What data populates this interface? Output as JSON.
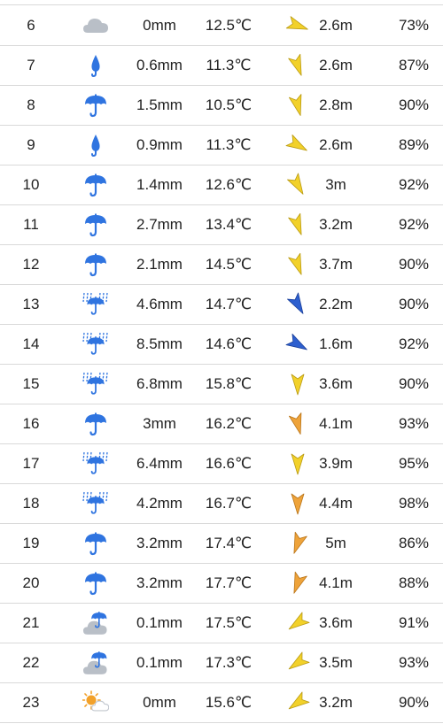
{
  "colors": {
    "divider": "#d9d9d9",
    "rain": "#2f74e0",
    "cloud": "#b9bfc7",
    "sun": "#f2a12a",
    "wind_yellow": "#f2d12a",
    "wind_orange": "#eea33a",
    "wind_blue": "#2d5fcf"
  },
  "rows": [
    {
      "hour": "6",
      "icon": "cloud-icon",
      "precip": "0mm",
      "temp": "12.5℃",
      "wind_dir": 110,
      "wind_color": "yellow",
      "wind": "2.6m",
      "humidity": "73%"
    },
    {
      "hour": "7",
      "icon": "raindrop-icon",
      "precip": "0.6mm",
      "temp": "11.3℃",
      "wind_dir": 160,
      "wind_color": "yellow",
      "wind": "2.6m",
      "humidity": "87%"
    },
    {
      "hour": "8",
      "icon": "umbrella-icon",
      "precip": "1.5mm",
      "temp": "10.5℃",
      "wind_dir": 165,
      "wind_color": "yellow",
      "wind": "2.8m",
      "humidity": "90%"
    },
    {
      "hour": "9",
      "icon": "raindrop-icon",
      "precip": "0.9mm",
      "temp": "11.3℃",
      "wind_dir": 120,
      "wind_color": "yellow",
      "wind": "2.6m",
      "humidity": "89%"
    },
    {
      "hour": "10",
      "icon": "umbrella-icon",
      "precip": "1.4mm",
      "temp": "12.6℃",
      "wind_dir": 150,
      "wind_color": "yellow",
      "wind": "3m",
      "humidity": "92%"
    },
    {
      "hour": "11",
      "icon": "umbrella-icon",
      "precip": "2.7mm",
      "temp": "13.4℃",
      "wind_dir": 160,
      "wind_color": "yellow",
      "wind": "3.2m",
      "humidity": "92%"
    },
    {
      "hour": "12",
      "icon": "umbrella-icon",
      "precip": "2.1mm",
      "temp": "14.5℃",
      "wind_dir": 160,
      "wind_color": "yellow",
      "wind": "3.7m",
      "humidity": "90%"
    },
    {
      "hour": "13",
      "icon": "umbrella-rain-icon",
      "precip": "4.6mm",
      "temp": "14.7℃",
      "wind_dir": 150,
      "wind_color": "blue",
      "wind": "2.2m",
      "humidity": "90%"
    },
    {
      "hour": "14",
      "icon": "umbrella-rain-icon",
      "precip": "8.5mm",
      "temp": "14.6℃",
      "wind_dir": 120,
      "wind_color": "blue",
      "wind": "1.6m",
      "humidity": "92%"
    },
    {
      "hour": "15",
      "icon": "umbrella-rain-icon",
      "precip": "6.8mm",
      "temp": "15.8℃",
      "wind_dir": 180,
      "wind_color": "yellow",
      "wind": "3.6m",
      "humidity": "90%"
    },
    {
      "hour": "16",
      "icon": "umbrella-icon",
      "precip": "3mm",
      "temp": "16.2℃",
      "wind_dir": 165,
      "wind_color": "orange",
      "wind": "4.1m",
      "humidity": "93%"
    },
    {
      "hour": "17",
      "icon": "umbrella-rain-icon",
      "precip": "6.4mm",
      "temp": "16.6℃",
      "wind_dir": 180,
      "wind_color": "yellow",
      "wind": "3.9m",
      "humidity": "95%"
    },
    {
      "hour": "18",
      "icon": "umbrella-rain-icon",
      "precip": "4.2mm",
      "temp": "16.7℃",
      "wind_dir": 180,
      "wind_color": "orange",
      "wind": "4.4m",
      "humidity": "98%"
    },
    {
      "hour": "19",
      "icon": "umbrella-icon",
      "precip": "3.2mm",
      "temp": "17.4℃",
      "wind_dir": 200,
      "wind_color": "orange",
      "wind": "5m",
      "humidity": "86%"
    },
    {
      "hour": "20",
      "icon": "umbrella-icon",
      "precip": "3.2mm",
      "temp": "17.7℃",
      "wind_dir": 200,
      "wind_color": "orange",
      "wind": "4.1m",
      "humidity": "88%"
    },
    {
      "hour": "21",
      "icon": "cloud-umbrella-icon",
      "precip": "0.1mm",
      "temp": "17.5℃",
      "wind_dir": 235,
      "wind_color": "yellow",
      "wind": "3.6m",
      "humidity": "91%"
    },
    {
      "hour": "22",
      "icon": "cloud-umbrella-icon",
      "precip": "0.1mm",
      "temp": "17.3℃",
      "wind_dir": 235,
      "wind_color": "yellow",
      "wind": "3.5m",
      "humidity": "93%"
    },
    {
      "hour": "23",
      "icon": "sun-cloud-icon",
      "precip": "0mm",
      "temp": "15.6℃",
      "wind_dir": 235,
      "wind_color": "yellow",
      "wind": "3.2m",
      "humidity": "90%"
    }
  ]
}
